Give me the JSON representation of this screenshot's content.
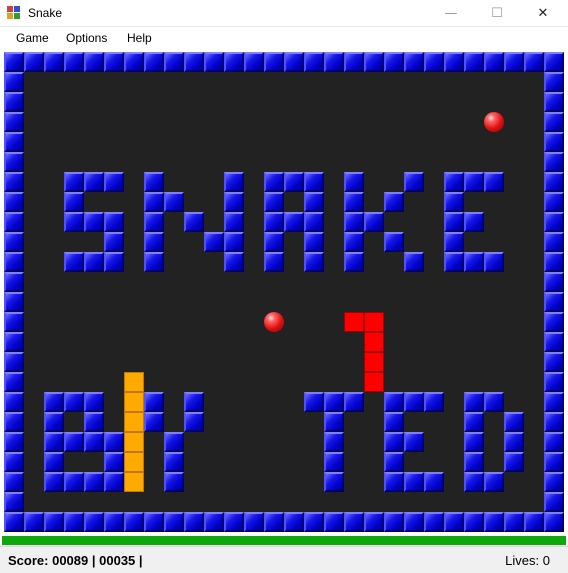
{
  "window": {
    "title": "Snake",
    "minimize_glyph": "—",
    "maximize_glyph": "☐",
    "close_glyph": "✕"
  },
  "menu": {
    "items": [
      "Game",
      "Options",
      "Help"
    ]
  },
  "status": {
    "score_label": "Score:",
    "score": "00089",
    "secondary": "00035",
    "lives_label": "Lives:",
    "lives": "0"
  },
  "colors": {
    "wall": "#0000c8",
    "board_background": "#222222",
    "snake_red": "#ff0000",
    "snake_orange": "#ffaa00",
    "apple": "#e01010",
    "progress_bar": "#0ca80c"
  },
  "game": {
    "grid_columns": 28,
    "grid_rows": 24,
    "banner_text": [
      "SNAKE",
      "BY TED"
    ],
    "walls": [
      [
        3,
        6
      ],
      [
        4,
        6
      ],
      [
        5,
        6
      ],
      [
        3,
        7
      ],
      [
        3,
        8
      ],
      [
        4,
        8
      ],
      [
        5,
        8
      ],
      [
        5,
        9
      ],
      [
        3,
        10
      ],
      [
        4,
        10
      ],
      [
        5,
        10
      ],
      [
        7,
        6
      ],
      [
        7,
        7
      ],
      [
        7,
        8
      ],
      [
        7,
        9
      ],
      [
        7,
        10
      ],
      [
        8,
        7
      ],
      [
        9,
        8
      ],
      [
        10,
        9
      ],
      [
        11,
        6
      ],
      [
        11,
        7
      ],
      [
        11,
        8
      ],
      [
        11,
        9
      ],
      [
        11,
        10
      ],
      [
        13,
        6
      ],
      [
        14,
        6
      ],
      [
        15,
        6
      ],
      [
        13,
        7
      ],
      [
        15,
        7
      ],
      [
        13,
        8
      ],
      [
        14,
        8
      ],
      [
        15,
        8
      ],
      [
        13,
        9
      ],
      [
        15,
        9
      ],
      [
        13,
        10
      ],
      [
        15,
        10
      ],
      [
        17,
        6
      ],
      [
        17,
        7
      ],
      [
        17,
        8
      ],
      [
        17,
        9
      ],
      [
        17,
        10
      ],
      [
        18,
        8
      ],
      [
        19,
        7
      ],
      [
        20,
        6
      ],
      [
        19,
        9
      ],
      [
        20,
        10
      ],
      [
        22,
        6
      ],
      [
        23,
        6
      ],
      [
        24,
        6
      ],
      [
        22,
        7
      ],
      [
        22,
        8
      ],
      [
        23,
        8
      ],
      [
        22,
        9
      ],
      [
        22,
        10
      ],
      [
        23,
        10
      ],
      [
        24,
        10
      ],
      [
        2,
        17
      ],
      [
        3,
        17
      ],
      [
        4,
        17
      ],
      [
        2,
        18
      ],
      [
        4,
        18
      ],
      [
        2,
        19
      ],
      [
        3,
        19
      ],
      [
        4,
        19
      ],
      [
        5,
        19
      ],
      [
        2,
        20
      ],
      [
        5,
        20
      ],
      [
        2,
        21
      ],
      [
        3,
        21
      ],
      [
        4,
        21
      ],
      [
        5,
        21
      ],
      [
        7,
        17
      ],
      [
        9,
        17
      ],
      [
        7,
        18
      ],
      [
        9,
        18
      ],
      [
        8,
        19
      ],
      [
        8,
        20
      ],
      [
        8,
        21
      ],
      [
        15,
        17
      ],
      [
        16,
        17
      ],
      [
        17,
        17
      ],
      [
        16,
        18
      ],
      [
        16,
        19
      ],
      [
        16,
        20
      ],
      [
        16,
        21
      ],
      [
        19,
        17
      ],
      [
        20,
        17
      ],
      [
        21,
        17
      ],
      [
        19,
        18
      ],
      [
        19,
        19
      ],
      [
        20,
        19
      ],
      [
        19,
        20
      ],
      [
        19,
        21
      ],
      [
        20,
        21
      ],
      [
        21,
        21
      ],
      [
        23,
        17
      ],
      [
        24,
        17
      ],
      [
        23,
        18
      ],
      [
        25,
        18
      ],
      [
        23,
        19
      ],
      [
        25,
        19
      ],
      [
        23,
        20
      ],
      [
        25,
        20
      ],
      [
        23,
        21
      ],
      [
        24,
        21
      ]
    ],
    "red_snake": [
      [
        17,
        13
      ],
      [
        18,
        13
      ],
      [
        18,
        14
      ],
      [
        18,
        15
      ],
      [
        18,
        16
      ]
    ],
    "orange_snake": [
      [
        6,
        16
      ],
      [
        6,
        17
      ],
      [
        6,
        18
      ],
      [
        6,
        19
      ],
      [
        6,
        20
      ],
      [
        6,
        21
      ]
    ],
    "apples": [
      [
        24,
        3
      ],
      [
        13,
        13
      ]
    ]
  }
}
